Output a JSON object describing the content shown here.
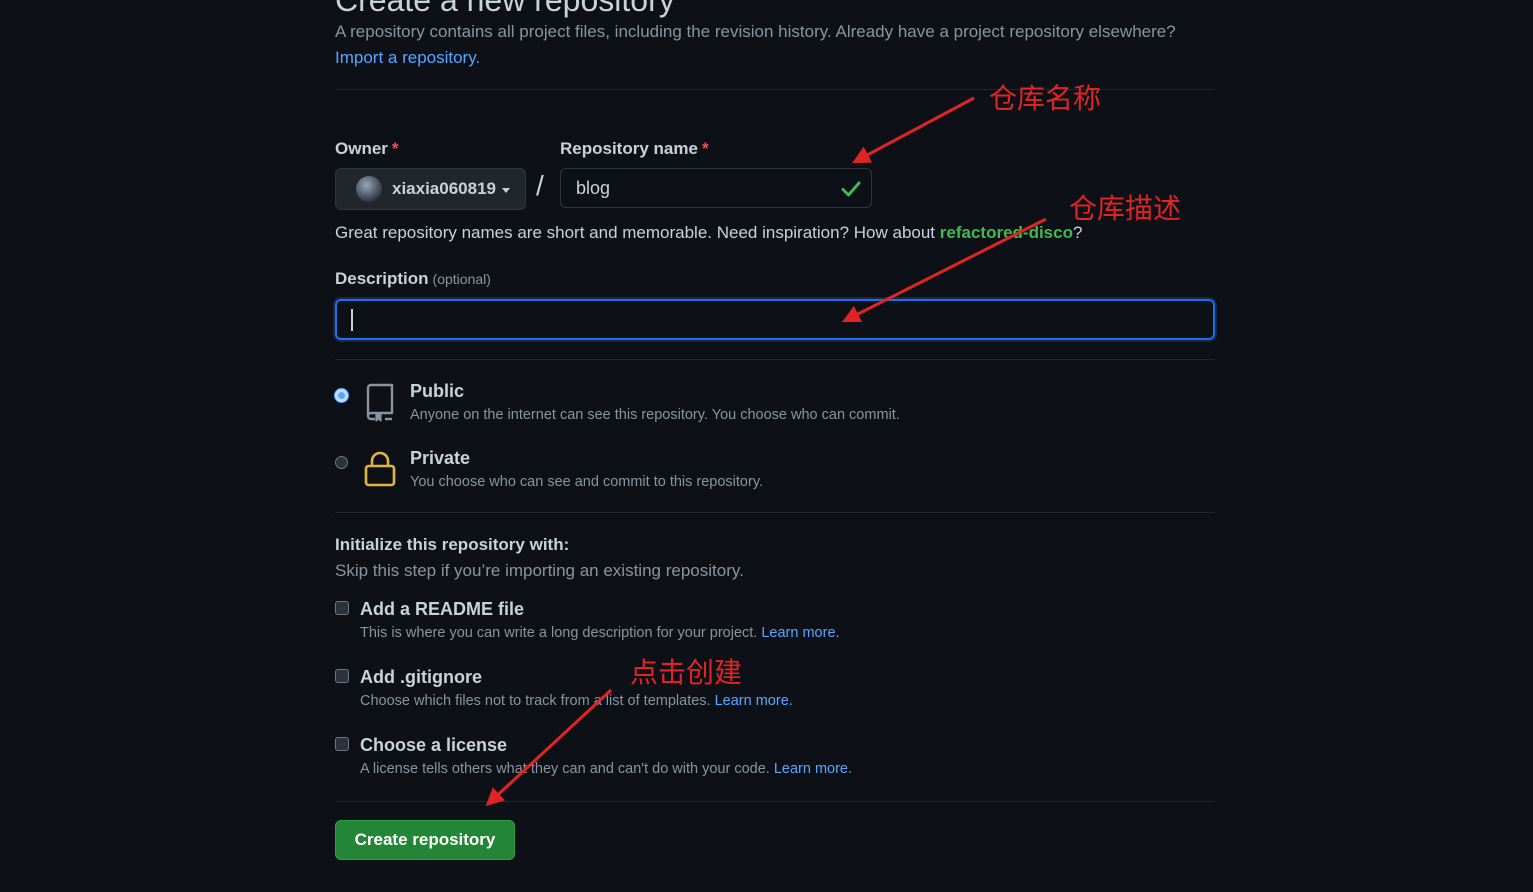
{
  "header": {
    "title": "Create a new repository",
    "intro_text": "A repository contains all project files, including the revision history. Already have a project repository elsewhere?",
    "import_link": "Import a repository."
  },
  "owner": {
    "label": "Owner",
    "required_mark": "*",
    "value": "xiaxia060819",
    "avatar_icon": "avatar-icon",
    "caret_icon": "caret-down-icon"
  },
  "slash": "/",
  "repo_name": {
    "label": "Repository name",
    "required_mark": "*",
    "value": "blog",
    "valid_icon": "check-icon"
  },
  "hint": {
    "prefix": "Great repository names are short and memorable. Need inspiration? How about ",
    "suggestion": "refactored-disco",
    "suffix": "?"
  },
  "description": {
    "label": "Description",
    "optional": "(optional)",
    "value": ""
  },
  "visibility": {
    "public": {
      "title": "Public",
      "desc": "Anyone on the internet can see this repository. You choose who can commit.",
      "icon": "repo-icon",
      "selected": true
    },
    "private": {
      "title": "Private",
      "desc": "You choose who can see and commit to this repository.",
      "icon": "lock-icon",
      "selected": false
    }
  },
  "init": {
    "title": "Initialize this repository with:",
    "subtitle": "Skip this step if you’re importing an existing repository.",
    "options": [
      {
        "title": "Add a README file",
        "desc": "This is where you can write a long description for your project.",
        "link": "Learn more.",
        "checked": false
      },
      {
        "title": "Add .gitignore",
        "desc": "Choose which files not to track from a list of templates.",
        "link": "Learn more.",
        "checked": false
      },
      {
        "title": "Choose a license",
        "desc": "A license tells others what they can and can't do with your code.",
        "link": "Learn more.",
        "checked": false
      }
    ]
  },
  "submit": {
    "label": "Create repository"
  },
  "annotations": {
    "repo_name": "仓库名称",
    "description": "仓库描述",
    "create": "点击创建"
  },
  "colors": {
    "background": "#0d1117",
    "accent_blue": "#58a6ff",
    "success_green": "#238636",
    "annotation_red": "#e02424"
  }
}
